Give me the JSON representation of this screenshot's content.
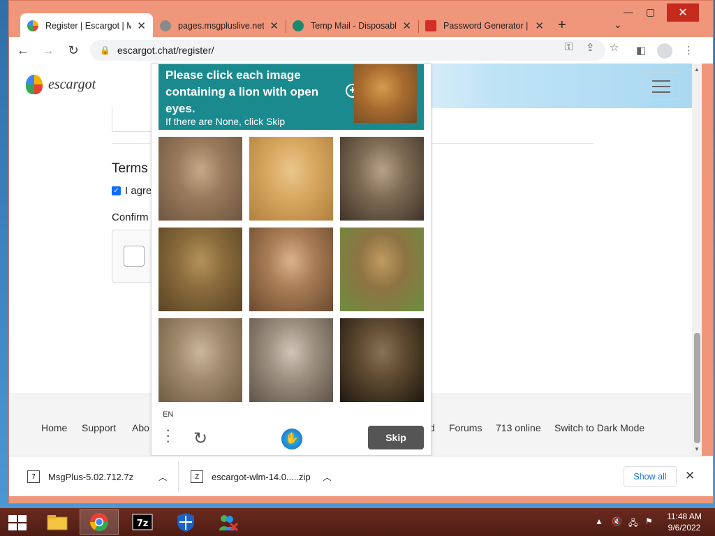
{
  "browser": {
    "tabs": [
      {
        "title": "Register | Escargot | MSN",
        "favicon_color": "#e94235",
        "active": true
      },
      {
        "title": "pages.msgpluslive.net",
        "favicon_color": "#9e9e9e",
        "active": false
      },
      {
        "title": "Temp Mail - Disposable",
        "favicon_color": "#1a8a6b",
        "active": false
      },
      {
        "title": "Password Generator | LastPass",
        "favicon_color": "#d32d27",
        "active": false
      }
    ],
    "new_tab": "+",
    "url": "escargot.chat/register/"
  },
  "site": {
    "logo_text": "escargot",
    "terms_title": "Terms",
    "agree_text": "I agre",
    "confirm_label": "Confirm",
    "footer_links": [
      "Home",
      "Support",
      "Abo",
      "d",
      "Forums",
      "713 online",
      "Switch to Dark Mode"
    ]
  },
  "captcha": {
    "prompt": "Please click each image containing a lion with open eyes.",
    "subprompt": "If there are None, click Skip",
    "language": "EN",
    "skip_label": "Skip",
    "tiles": [
      {
        "colors": [
          "#9a7a5c",
          "#6d5640",
          "#c7a989"
        ]
      },
      {
        "colors": [
          "#d9a860",
          "#b0803f",
          "#e9c78e"
        ]
      },
      {
        "colors": [
          "#7e6b55",
          "#3f3327",
          "#b8a388"
        ]
      },
      {
        "colors": [
          "#8a6b3c",
          "#5a4424",
          "#b4925a"
        ]
      },
      {
        "colors": [
          "#a87c55",
          "#6b4a2f",
          "#d9b28c"
        ]
      },
      {
        "colors": [
          "#8d7343",
          "#6c8f3e",
          "#c19a5f"
        ]
      },
      {
        "colors": [
          "#a28a6c",
          "#6f5c44",
          "#cbb79c"
        ]
      },
      {
        "colors": [
          "#9d8f80",
          "#5e5348",
          "#cfc5b8"
        ]
      },
      {
        "colors": [
          "#5e4a30",
          "#1f1810",
          "#8a7252"
        ]
      }
    ]
  },
  "downloads": {
    "items": [
      {
        "name": "MsgPlus-5.02.712.7z"
      },
      {
        "name": "escargot-wlm-14.0.....zip"
      }
    ],
    "show_all": "Show all"
  },
  "taskbar": {
    "time": "11:48 AM",
    "date": "9/6/2022",
    "apps": [
      "file-explorer",
      "chrome",
      "7zip",
      "windows-security",
      "msn-messenger"
    ]
  },
  "colors": {
    "window_frame": "#f0967a",
    "captcha_header": "#1a8a8f",
    "taskbar": "#5c2218"
  }
}
